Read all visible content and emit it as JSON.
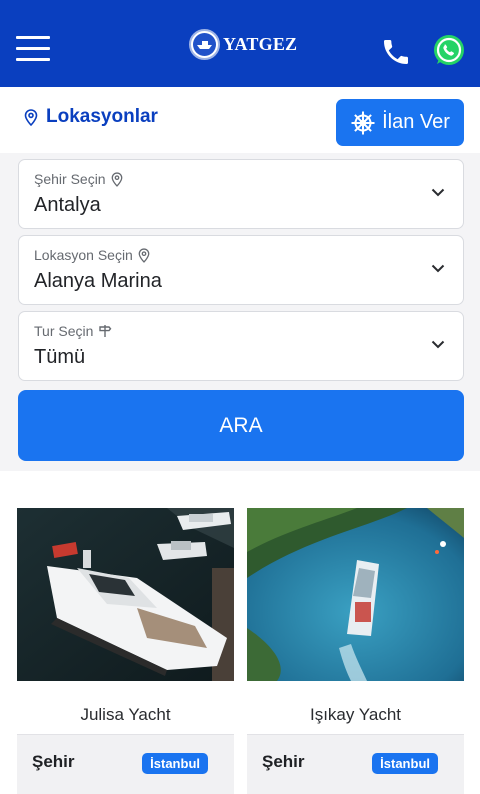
{
  "header": {
    "logo_text": "YATGEZ",
    "menu_icon": "hamburger-menu-icon",
    "phone_icon": "phone-icon",
    "whatsapp_icon": "whatsapp-icon",
    "background": "#0a3fbf"
  },
  "location_bar": {
    "title": "Lokasyonlar",
    "title_icon": "location-pin-icon",
    "cta_label": "İlan Ver",
    "cta_icon": "ship-wheel-icon"
  },
  "search": {
    "city": {
      "label": "Şehir Seçin",
      "value": "Antalya"
    },
    "location": {
      "label": "Lokasyon Seçin",
      "value": "Alanya Marina"
    },
    "tour": {
      "label": "Tur Seçin",
      "value": "Tümü"
    },
    "submit_label": "ARA"
  },
  "listings": [
    {
      "title": "Julisa Yacht",
      "info_key": "Şehir",
      "info_value": "İstanbul"
    },
    {
      "title": "Işıkay Yacht",
      "info_key": "Şehir",
      "info_value": "İstanbul"
    }
  ],
  "colors": {
    "brand_dark": "#0a3fbf",
    "accent": "#1a74f0",
    "panel_bg": "#f4f4f6"
  }
}
